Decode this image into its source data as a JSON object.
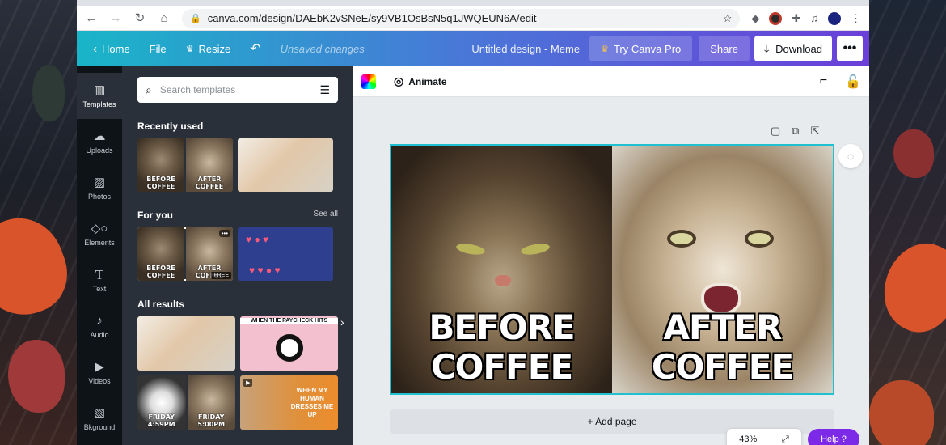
{
  "browser": {
    "url": "canva.com/design/DAEbK2vSNeE/sy9VB1OsBsN5q1JWQEUN6A/edit"
  },
  "topbar": {
    "home": "Home",
    "file": "File",
    "resize": "Resize",
    "unsaved": "Unsaved changes",
    "title": "Untitled design - Meme",
    "try_pro": "Try Canva Pro",
    "share": "Share",
    "download": "Download"
  },
  "rail": [
    {
      "label": "Templates",
      "icon": "templates-icon"
    },
    {
      "label": "Uploads",
      "icon": "upload-icon"
    },
    {
      "label": "Photos",
      "icon": "photos-icon"
    },
    {
      "label": "Elements",
      "icon": "elements-icon"
    },
    {
      "label": "Text",
      "icon": "text-icon"
    },
    {
      "label": "Audio",
      "icon": "audio-icon"
    },
    {
      "label": "Videos",
      "icon": "videos-icon"
    },
    {
      "label": "Bkground",
      "icon": "background-icon"
    }
  ],
  "panel": {
    "search_placeholder": "Search templates",
    "recently_used": "Recently used",
    "for_you": "For you",
    "see_all": "See all",
    "all_results": "All results",
    "badge_free": "FREE",
    "thumb_captions": {
      "before_coffee": "BEFORE COFFEE",
      "after_coffee": "AFTER COFFEE",
      "paycheck": "WHEN THE PAYCHECK HITS",
      "pug": "WHEN MY HUMAN DRESSES ME UP",
      "friday_left": "FRIDAY 4:59PM",
      "friday_right": "FRIDAY 5:00PM"
    }
  },
  "editor": {
    "animate": "Animate",
    "caption_left": "BEFORE COFFEE",
    "caption_right": "AFTER COFFEE",
    "add_page": "+ Add page",
    "zoom": "43%",
    "help": "Help ?"
  },
  "colors": {
    "accent": "#7d2ae8",
    "selection": "#1fc1d1"
  }
}
